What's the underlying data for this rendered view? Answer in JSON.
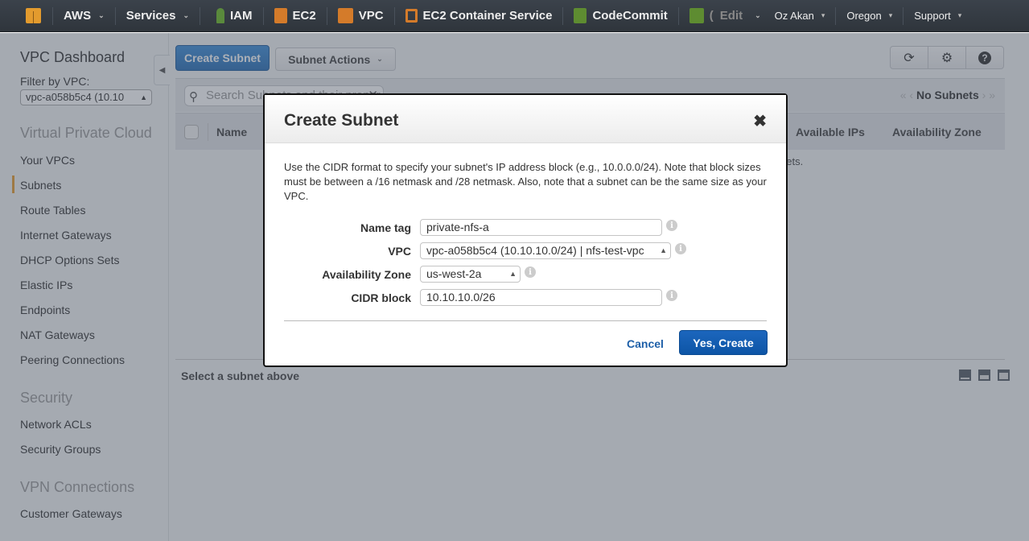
{
  "topnav": {
    "logo": "aws-cube-icon",
    "items": [
      {
        "label": "AWS",
        "dropdown": true
      },
      {
        "label": "Services",
        "dropdown": true
      },
      {
        "label": "IAM",
        "icon": "iam-key-icon",
        "icon_color": "#5a8a3c"
      },
      {
        "label": "EC2",
        "icon": "ec2-icon",
        "icon_color": "#d47b2a"
      },
      {
        "label": "VPC",
        "icon": "vpc-icon",
        "icon_color": "#d47b2a"
      },
      {
        "label": "EC2 Container Service",
        "icon": "ecs-icon",
        "icon_color": "#d47b2a"
      },
      {
        "label": "CodeCommit",
        "icon": "codecommit-icon",
        "icon_color": "#5e8c31"
      },
      {
        "label": "(",
        "icon": "codedeploy-icon",
        "icon_color": "#5e8c31"
      },
      {
        "label": "Edit",
        "dropdown": true
      }
    ],
    "user": "Oz Akan",
    "region": "Oregon",
    "support": "Support"
  },
  "sidebar": {
    "title": "VPC Dashboard",
    "filter_label": "Filter by VPC:",
    "filter_value": "vpc-a058b5c4 (10.10",
    "sections": [
      {
        "title": "Virtual Private Cloud",
        "items": [
          "Your VPCs",
          "Subnets",
          "Route Tables",
          "Internet Gateways",
          "DHCP Options Sets",
          "Elastic IPs",
          "Endpoints",
          "NAT Gateways",
          "Peering Connections"
        ]
      },
      {
        "title": "Security",
        "items": [
          "Network ACLs",
          "Security Groups"
        ]
      },
      {
        "title": "VPN Connections",
        "items": [
          "Customer Gateways"
        ]
      }
    ],
    "active_item": "Subnets",
    "accent_color": "#e59b2e"
  },
  "main": {
    "create_button": "Create Subnet",
    "actions_button": "Subnet Actions",
    "search_placeholder": "Search Subnets and their proper",
    "pager": "No Subnets",
    "columns": [
      "Name",
      "Available IPs",
      "Availability Zone"
    ],
    "empty_message": "o not have any Subnets.",
    "detail_title": "Select a subnet above",
    "toolbar_icons": [
      "refresh-icon",
      "gear-icon",
      "help-icon"
    ]
  },
  "modal": {
    "title": "Create Subnet",
    "description": "Use the CIDR format to specify your subnet's IP address block (e.g., 10.0.0.0/24). Note that block sizes must be between a /16 netmask and /28 netmask. Also, note that a subnet can be the same size as your VPC.",
    "fields": {
      "name_tag": {
        "label": "Name tag",
        "value": "private-nfs-a"
      },
      "vpc": {
        "label": "VPC",
        "value": "vpc-a058b5c4 (10.10.10.0/24) | nfs-test-vpc"
      },
      "availability_zone": {
        "label": "Availability Zone",
        "value": "us-west-2a"
      },
      "cidr_block": {
        "label": "CIDR block",
        "value": "10.10.10.0/26"
      }
    },
    "cancel_label": "Cancel",
    "create_label": "Yes, Create",
    "primary_color": "#0d55a6"
  }
}
